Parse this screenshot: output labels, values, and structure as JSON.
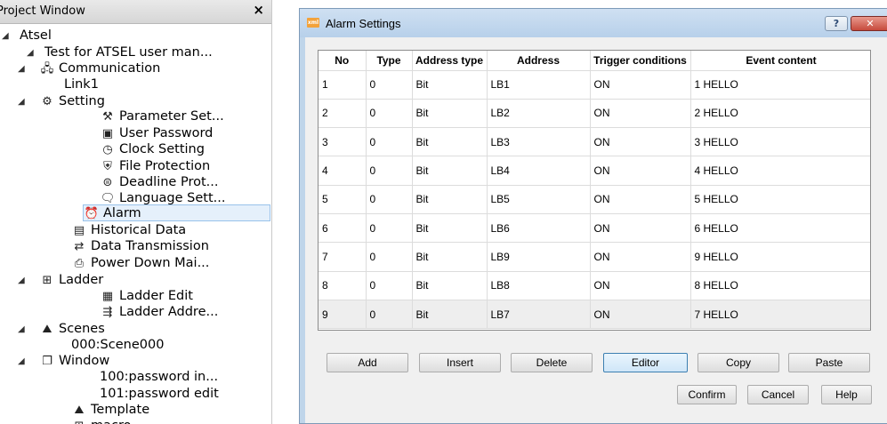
{
  "project": {
    "title": "Project Window",
    "close": "×",
    "tree": [
      {
        "label": "Atsel",
        "icon": "",
        "toggle": "◢"
      },
      {
        "label": "Test for ATSEL user man...",
        "icon": "",
        "toggle": "◢"
      },
      {
        "label": "Communication",
        "icon": "🖧",
        "toggle": "◢"
      },
      {
        "label": "Link1",
        "icon": "",
        "toggle": ""
      },
      {
        "label": "Setting",
        "icon": "⚙",
        "toggle": "◢"
      },
      {
        "label": "Parameter Set...",
        "icon": "⚒",
        "toggle": ""
      },
      {
        "label": "User Password",
        "icon": "▣",
        "toggle": ""
      },
      {
        "label": "Clock Setting",
        "icon": "◷",
        "toggle": ""
      },
      {
        "label": "File Protection",
        "icon": "⛨",
        "toggle": ""
      },
      {
        "label": "Deadline Prot...",
        "icon": "⊜",
        "toggle": ""
      },
      {
        "label": "Language Sett...",
        "icon": "🗨",
        "toggle": ""
      },
      {
        "label": "Alarm",
        "icon": "⏰",
        "toggle": ""
      },
      {
        "label": "Historical Data",
        "icon": "▤",
        "toggle": ""
      },
      {
        "label": "Data Transmission",
        "icon": "⇄",
        "toggle": ""
      },
      {
        "label": "Power Down Mai...",
        "icon": "⎙",
        "toggle": ""
      },
      {
        "label": "Ladder",
        "icon": "⊞",
        "toggle": "◢"
      },
      {
        "label": "Ladder Edit",
        "icon": "▦",
        "toggle": ""
      },
      {
        "label": "Ladder Addre...",
        "icon": "⇶",
        "toggle": ""
      },
      {
        "label": "Scenes",
        "icon": "⛰",
        "toggle": "◢"
      },
      {
        "label": "000:Scene000",
        "icon": "",
        "toggle": ""
      },
      {
        "label": "Window",
        "icon": "❐",
        "toggle": "◢"
      },
      {
        "label": "100:password in...",
        "icon": "",
        "toggle": ""
      },
      {
        "label": "101:password  edit",
        "icon": "",
        "toggle": ""
      },
      {
        "label": "Template",
        "icon": "⛰",
        "toggle": ""
      },
      {
        "label": "macro",
        "icon": "⊞",
        "toggle": ""
      }
    ]
  },
  "dialog": {
    "title": "Alarm Settings",
    "app_icon": "xml",
    "help_glyph": "?",
    "close_glyph": "✕",
    "columns": [
      "No",
      "Type",
      "Address type",
      "Address",
      "Trigger conditions",
      "Event content"
    ],
    "rows": [
      [
        "1",
        "0",
        "Bit",
        "LB1",
        "ON",
        "1 HELLO"
      ],
      [
        "2",
        "0",
        "Bit",
        "LB2",
        "ON",
        "2 HELLO"
      ],
      [
        "3",
        "0",
        "Bit",
        "LB3",
        "ON",
        "3 HELLO"
      ],
      [
        "4",
        "0",
        "Bit",
        "LB4",
        "ON",
        "4 HELLO"
      ],
      [
        "5",
        "0",
        "Bit",
        "LB5",
        "ON",
        "5 HELLO"
      ],
      [
        "6",
        "0",
        "Bit",
        "LB6",
        "ON",
        "6 HELLO"
      ],
      [
        "7",
        "0",
        "Bit",
        "LB9",
        "ON",
        "9 HELLO"
      ],
      [
        "8",
        "0",
        "Bit",
        "LB8",
        "ON",
        "8 HELLO"
      ],
      [
        "9",
        "0",
        "Bit",
        "LB7",
        "ON",
        "7 HELLO"
      ]
    ],
    "buttons": {
      "add": "Add",
      "insert": "Insert",
      "delete": "Delete",
      "editor": "Editor",
      "copy": "Copy",
      "paste": "Paste",
      "confirm": "Confirm",
      "cancel": "Cancel",
      "help": "Help"
    }
  }
}
